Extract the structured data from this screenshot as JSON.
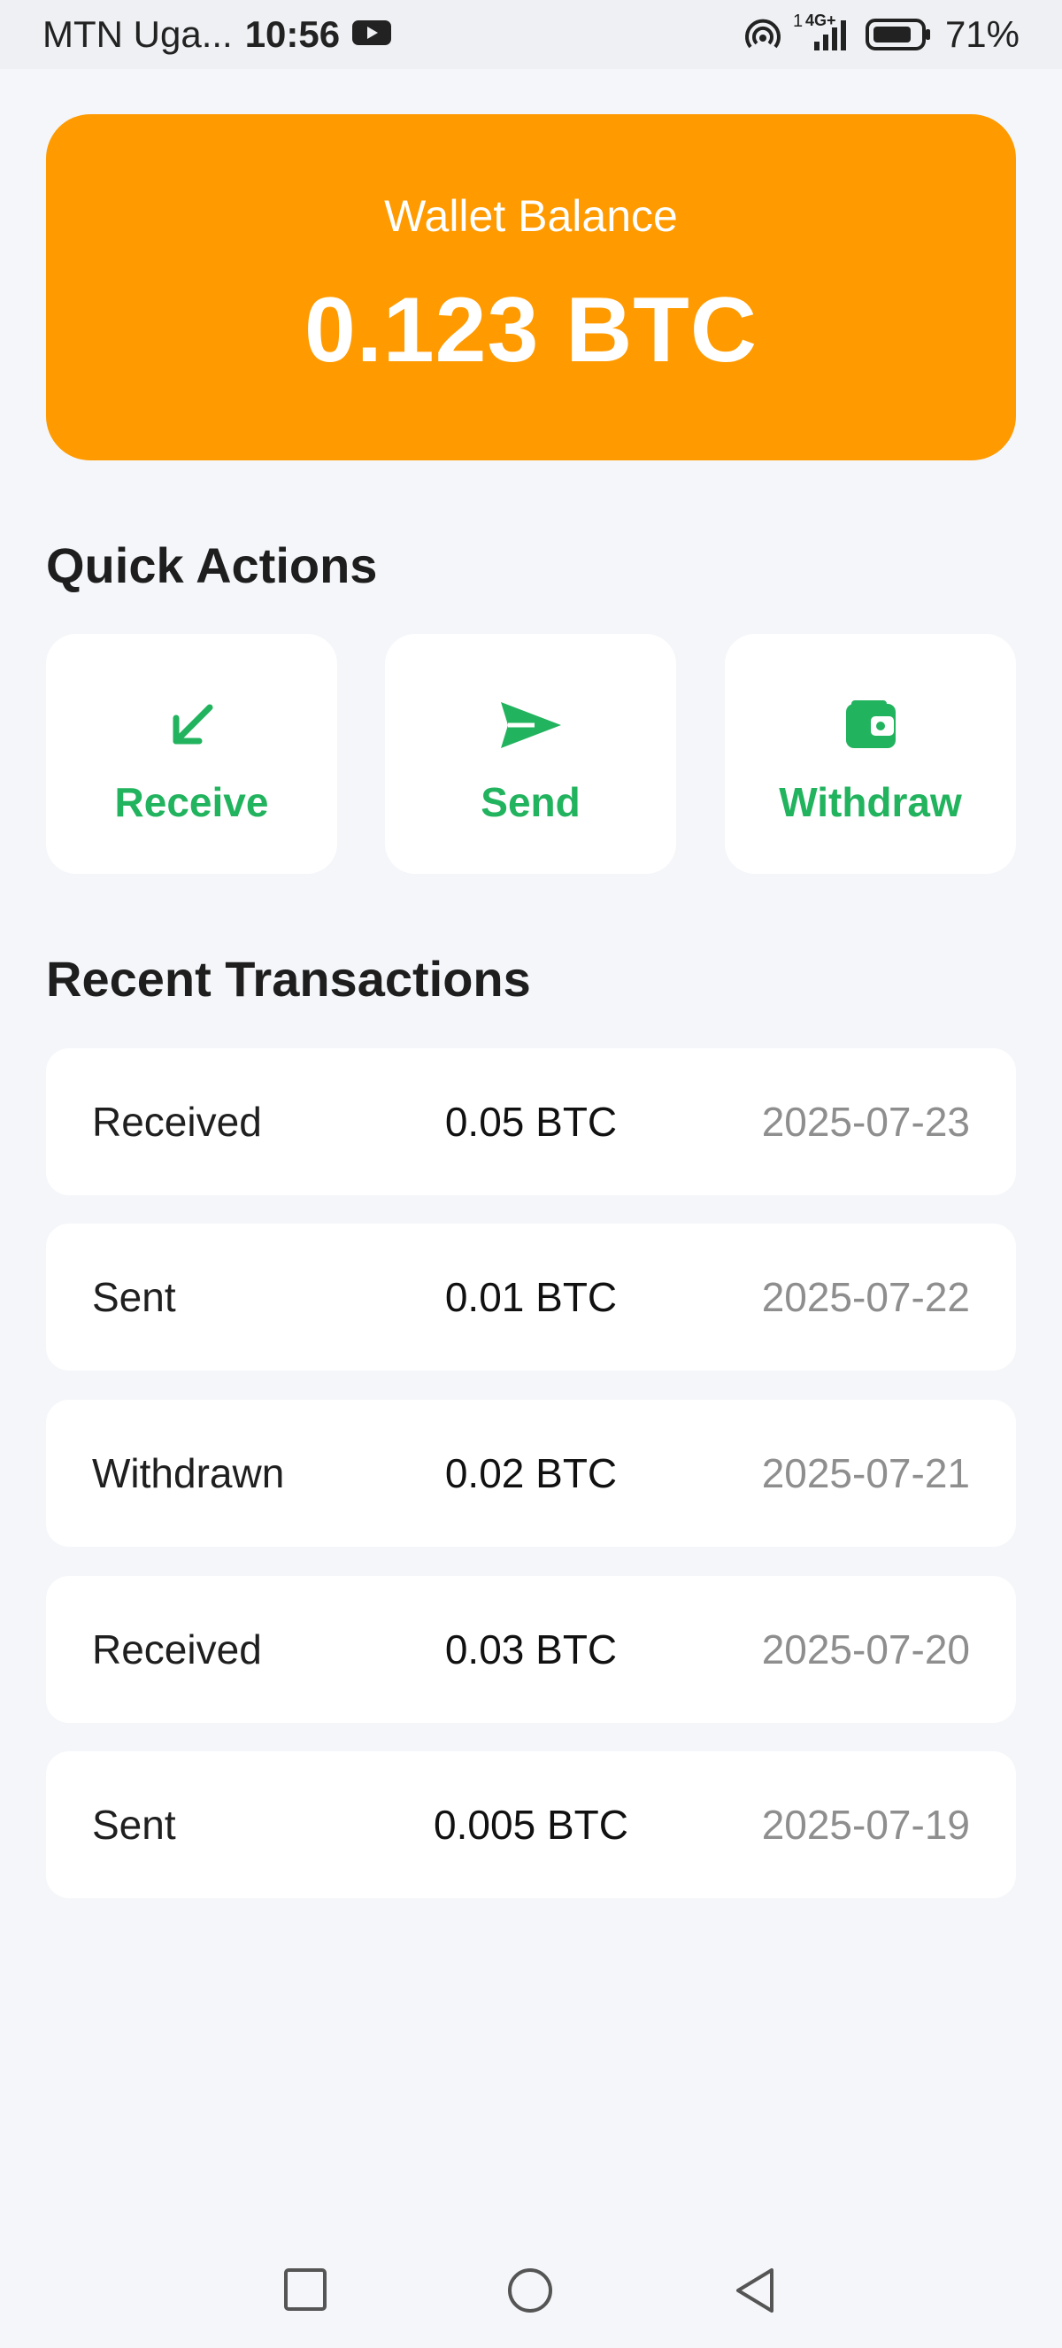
{
  "status_bar": {
    "carrier": "MTN Uga...",
    "time": "10:56",
    "network": "4G+",
    "sim": "1",
    "battery": "71%"
  },
  "balance": {
    "label": "Wallet Balance",
    "value": "0.123 BTC",
    "color": "#ff9a00"
  },
  "quick_actions": {
    "title": "Quick Actions",
    "accent": "#22b35e",
    "items": [
      {
        "label": "Receive",
        "icon": "arrow-down-left-icon"
      },
      {
        "label": "Send",
        "icon": "send-icon"
      },
      {
        "label": "Withdraw",
        "icon": "wallet-icon"
      }
    ]
  },
  "recent_transactions": {
    "title": "Recent Transactions",
    "items": [
      {
        "type": "Received",
        "amount": "0.05 BTC",
        "date": "2025-07-23"
      },
      {
        "type": "Sent",
        "amount": "0.01 BTC",
        "date": "2025-07-22"
      },
      {
        "type": "Withdrawn",
        "amount": "0.02 BTC",
        "date": "2025-07-21"
      },
      {
        "type": "Received",
        "amount": "0.03 BTC",
        "date": "2025-07-20"
      },
      {
        "type": "Sent",
        "amount": "0.005 BTC",
        "date": "2025-07-19"
      }
    ]
  },
  "nav_bar": {
    "items": [
      "recents-square-icon",
      "home-circle-icon",
      "back-triangle-icon"
    ]
  }
}
